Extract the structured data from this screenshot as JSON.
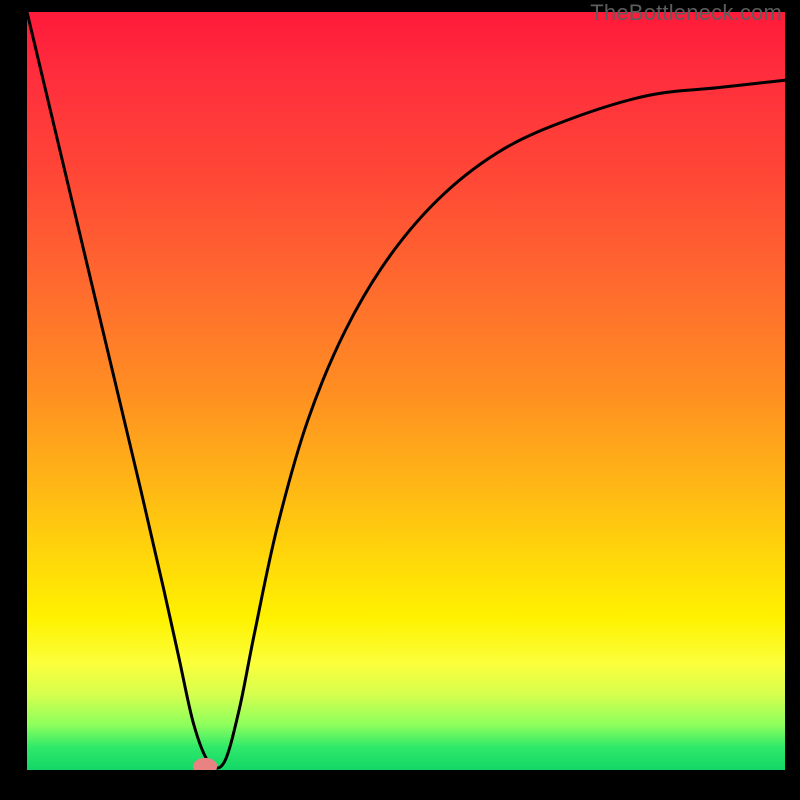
{
  "watermark": "TheBottleneck.com",
  "chart_data": {
    "type": "line",
    "title": "",
    "xlabel": "",
    "ylabel": "",
    "xlim": [
      0,
      100
    ],
    "ylim": [
      0,
      100
    ],
    "series": [
      {
        "name": "bottleneck-curve",
        "x": [
          0,
          5,
          10,
          15,
          18,
          20,
          22,
          24,
          26,
          28,
          30,
          33,
          37,
          42,
          48,
          55,
          63,
          72,
          82,
          91,
          100
        ],
        "y": [
          100,
          79,
          58,
          37,
          24,
          15,
          6,
          1,
          1,
          8,
          18,
          32,
          46,
          58,
          68,
          76,
          82,
          86,
          89,
          90,
          91
        ]
      }
    ],
    "marker": {
      "x": 23.5,
      "y": 0.5,
      "rx": 1.6,
      "ry": 1.1,
      "color": "#e98383"
    },
    "background_gradient": {
      "top": "#ff1a3a",
      "mid": "#ffd70a",
      "bottom": "#13d667"
    }
  },
  "plot": {
    "inner_w": 758,
    "inner_h": 758
  }
}
